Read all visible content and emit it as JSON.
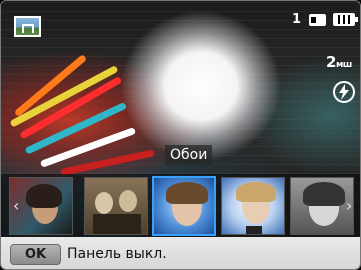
{
  "status": {
    "mode_icon": "wallpaper-thumbnail-icon",
    "shot_count": "1",
    "storage_icon": "memory-card-icon",
    "battery_icon": "battery-full-icon",
    "resolution": "2",
    "resolution_unit": "мш",
    "flash_icon": "flash-auto-icon"
  },
  "effect": {
    "label": "Обои"
  },
  "filmstrip": {
    "left_arrow": "‹",
    "right_arrow": "›",
    "items": [
      {
        "name": "graffiti-portrait"
      },
      {
        "name": "sepia-children"
      },
      {
        "name": "blue-frame-portrait"
      },
      {
        "name": "blue-boat-portrait"
      },
      {
        "name": "bw-portrait"
      }
    ],
    "selected_index": 2
  },
  "bottom_bar": {
    "ok_label": "OK",
    "action_label": "Панель выкл."
  },
  "colors": {
    "selection": "#3aa0ff",
    "bar_background": "#e0e0e0"
  }
}
